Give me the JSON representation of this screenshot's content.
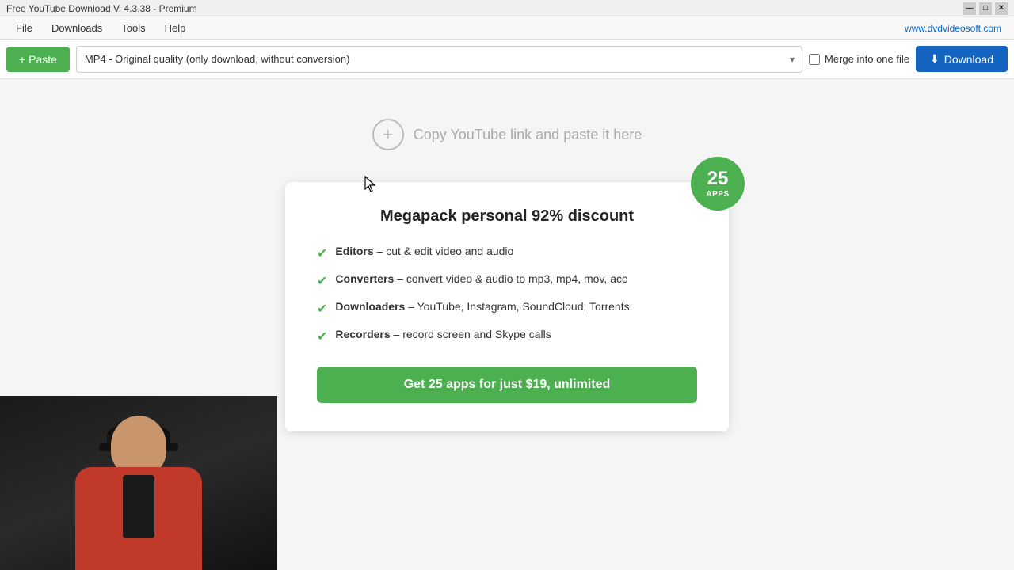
{
  "titleBar": {
    "title": "Free YouTube Download V. 4.3.38 - Premium",
    "controls": [
      "minimize",
      "maximize",
      "close"
    ]
  },
  "menuBar": {
    "items": [
      "File",
      "Downloads",
      "Tools",
      "Help"
    ],
    "siteLink": "www.dvdvideosoft.com"
  },
  "toolbar": {
    "pasteLabel": "+ Paste",
    "formatOptions": [
      "MP4 - Original quality (only download, without conversion)"
    ],
    "selectedFormat": "MP4 - Original quality (only download, without conversion)",
    "mergeLabel": "Merge into one file",
    "mergeChecked": false,
    "downloadLabel": "Download",
    "downloadIcon": "⬇"
  },
  "pasteArea": {
    "icon": "+",
    "text": "Copy YouTube link and paste it here"
  },
  "promoCard": {
    "badge": {
      "number": "25",
      "text": "APPS"
    },
    "title": "Megapack personal 92% discount",
    "features": [
      {
        "boldPart": "Editors",
        "rest": " – cut & edit video and audio"
      },
      {
        "boldPart": "Converters",
        "rest": " – convert video & audio to mp3, mp4, mov, acc"
      },
      {
        "boldPart": "Downloaders",
        "rest": " – YouTube, Instagram, SoundCloud, Torrents"
      },
      {
        "boldPart": "Recorders",
        "rest": " – record screen and Skype calls"
      }
    ],
    "ctaLabel": "Get 25 apps for just $19, unlimited"
  }
}
